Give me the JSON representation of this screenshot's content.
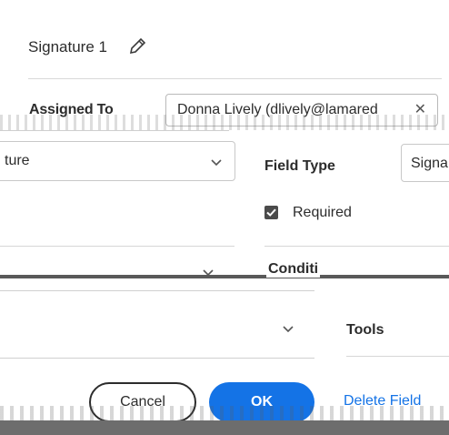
{
  "header": {
    "title": "Signature 1"
  },
  "assigned": {
    "label": "Assigned To",
    "value": "Donna Lively (dlively@lamared",
    "clear_icon": "close-icon"
  },
  "type_select": {
    "value": "ture"
  },
  "field_type": {
    "label": "Field Type",
    "value": "Signa"
  },
  "required": {
    "label": "Required",
    "checked": true
  },
  "conditions": {
    "label": "Conditi"
  },
  "tools": {
    "label": "Tools"
  },
  "footer": {
    "cancel_label": "Cancel",
    "ok_label": "OK",
    "delete_label": "Delete Field"
  },
  "colors": {
    "accent": "#1473e6",
    "text": "#2c2c2c",
    "border": "#c8c8c8"
  }
}
